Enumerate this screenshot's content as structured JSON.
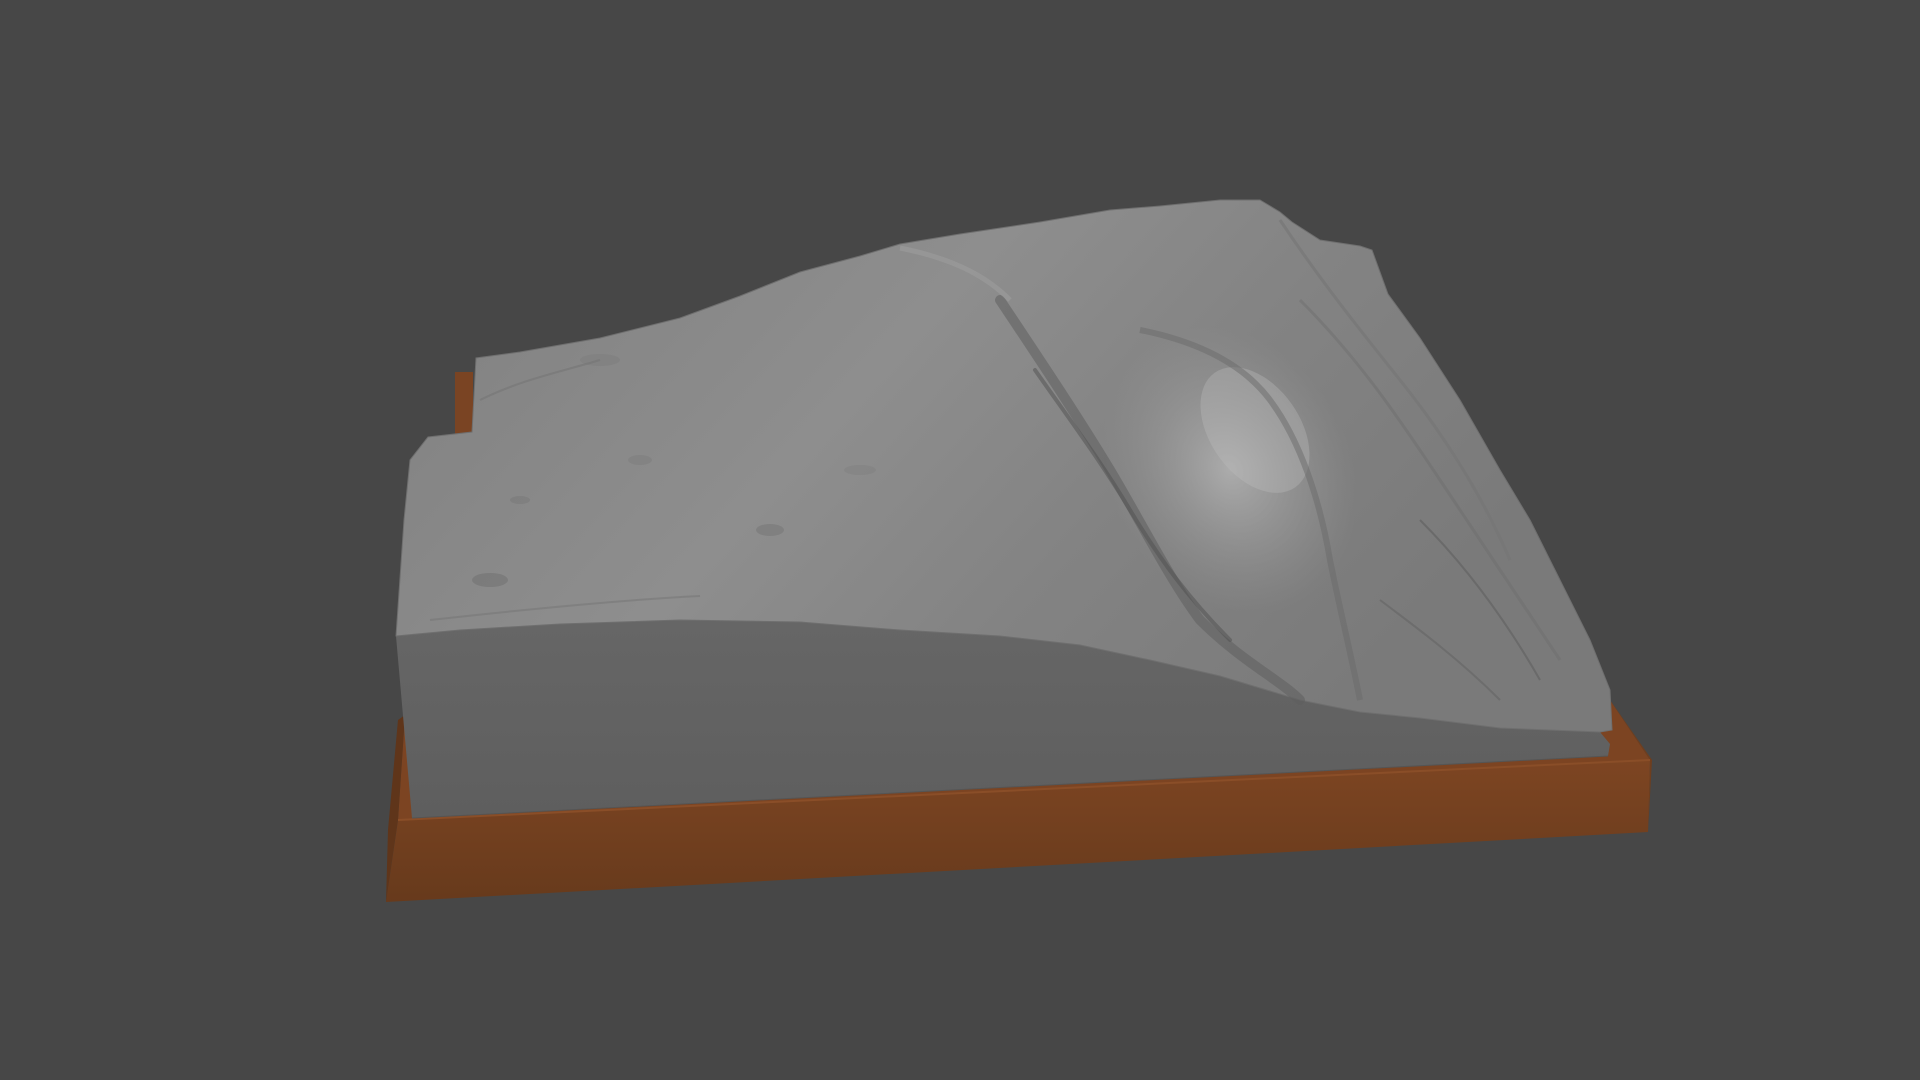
{
  "viewport": {
    "background_color": "#474747"
  },
  "model": {
    "terrain_color": "#8d8d8d",
    "side_color": "#626262",
    "base_color": "#7a4320",
    "base_front_color": "#6b3c1c"
  }
}
